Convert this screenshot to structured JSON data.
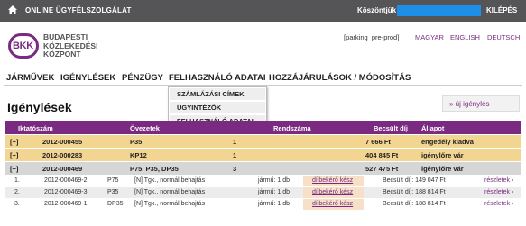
{
  "topbar": {
    "title": "ONLINE ÜGYFÉLSZOLGÁLAT",
    "thanks": "Köszöntjük",
    "logout": "KILÉPÉS",
    "accent": "#1e8fe6"
  },
  "logo": {
    "mark": "BKK",
    "lines": [
      "BUDAPESTI",
      "KÖZLEKEDÉSI",
      "KÖZPONT"
    ],
    "brand_color": "#7a2a80"
  },
  "env": "[parking_pre-prod]",
  "languages": [
    "MAGYAR",
    "ENGLISH",
    "DEUTSCH"
  ],
  "nav": [
    "JÁRMŰVEK",
    "IGÉNYLÉSEK",
    "PÉNZÜGY",
    "FELHASZNÁLÓ ADATAI",
    "HOZZÁJÁRULÁSOK / MÓDOSÍTÁS"
  ],
  "dropdown": [
    "SZÁMLÁZÁSI CÍMEK",
    "ÜGYINTÉZŐK",
    "FELHASZNÁLÓ ADATAI"
  ],
  "page_title": "Igénylések",
  "new_button": "» új igénylés",
  "table": {
    "headers": [
      "Iktatószám",
      "Övezetek",
      "Rendszáma",
      "Becsült díj",
      "Állapot"
    ],
    "rows": [
      {
        "toggle": "[+]",
        "id": "2012-000455",
        "zones": "P35",
        "count": "1",
        "fee": "7 666 Ft",
        "status": "engedély kiadva"
      },
      {
        "toggle": "[+]",
        "id": "2012-000283",
        "zones": "KP12",
        "count": "1",
        "fee": "404 845 Ft",
        "status": "igénylőre vár"
      },
      {
        "toggle": "[−]",
        "id": "2012-000469",
        "zones": "P75, P35, DP35",
        "count": "3",
        "fee": "527 475 Ft",
        "status": "igénylőre vár"
      }
    ],
    "subrows": [
      {
        "n": "1.",
        "id": "2012-000469-2",
        "zone": "P75",
        "desc": "[N] Tgk., normál behajtás",
        "vehicles": "jármű: 1 db",
        "link": "díjbekérő kész",
        "fee": "Becsült díj: 149 047 Ft",
        "details": "részletek ›"
      },
      {
        "n": "2.",
        "id": "2012-000469-3",
        "zone": "P35",
        "desc": "[N] Tgk., normál behajtás",
        "vehicles": "jármű: 1 db",
        "link": "díjbekérő kész",
        "fee": "Becsült díj: 188 814 Ft",
        "details": "részletek ›"
      },
      {
        "n": "3.",
        "id": "2012-000469-1",
        "zone": "DP35",
        "desc": "[N] Tgk., normál behajtás",
        "vehicles": "jármű: 1 db",
        "link": "díjbekérő kész",
        "fee": "Becsült díj: 188 814 Ft",
        "details": "részletek ›"
      }
    ]
  }
}
